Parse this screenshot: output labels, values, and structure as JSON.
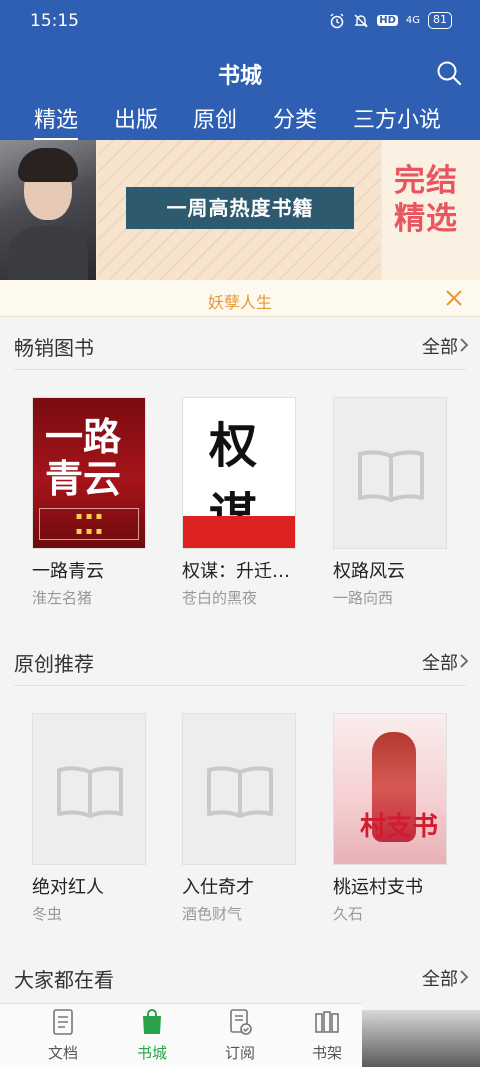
{
  "status": {
    "time": "15:15",
    "hd": "HD",
    "network": "4G",
    "battery": "81"
  },
  "header": {
    "title": "书城",
    "tabs": [
      "精选",
      "出版",
      "原创",
      "分类",
      "三方小说"
    ],
    "active_tab": 0
  },
  "banner": {
    "center_label": "一周高热度书籍",
    "right_label": "完结精选"
  },
  "notice": {
    "text": "妖孽人生"
  },
  "sections": [
    {
      "title": "畅销图书",
      "more": "全部",
      "books": [
        {
          "title": "一路青云",
          "author": "淮左名猪",
          "cover": "red",
          "cover_text": "一路青云"
        },
        {
          "title": "权谋：升迁…",
          "author": "苍白的黑夜",
          "cover": "white",
          "cover_text": "权谋"
        },
        {
          "title": "权路风云",
          "author": "一路向西",
          "cover": "placeholder"
        }
      ]
    },
    {
      "title": "原创推荐",
      "more": "全部",
      "books": [
        {
          "title": "绝对红人",
          "author": "冬虫",
          "cover": "placeholder"
        },
        {
          "title": "入仕奇才",
          "author": "酒色财气",
          "cover": "placeholder"
        },
        {
          "title": "桃运村支书",
          "author": "久石",
          "cover": "pink",
          "cover_text": "村支书"
        }
      ]
    },
    {
      "title": "大家都在看",
      "more": "全部"
    }
  ],
  "bottom_nav": [
    {
      "label": "文档",
      "icon": "document-icon"
    },
    {
      "label": "书城",
      "icon": "shopping-bag-icon",
      "active": true
    },
    {
      "label": "订阅",
      "icon": "subscribe-icon"
    },
    {
      "label": "书架",
      "icon": "bookshelf-icon"
    }
  ],
  "colors": {
    "primary": "#2f5fb3",
    "notice_text": "#e6983a",
    "active_nav": "#2aa34a",
    "banner_label": "#2d5a6e",
    "promo_red": "#e8565f"
  }
}
